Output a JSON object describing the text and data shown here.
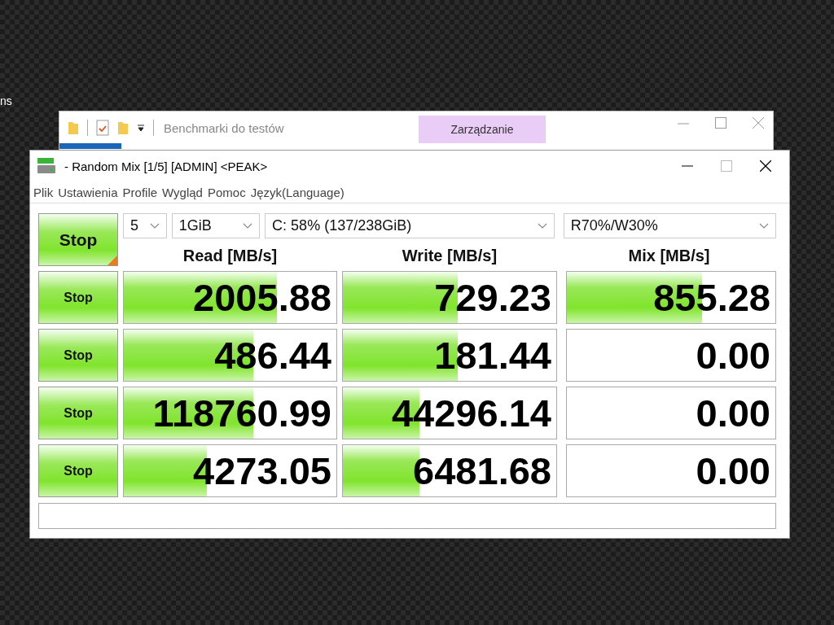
{
  "desktop": {
    "label": "ns"
  },
  "explorer": {
    "title": "Benchmarki do testów",
    "ribbon_tab": {
      "label": "Zarządzanie"
    }
  },
  "window": {
    "title": "- Random Mix [1/5] [ADMIN] <PEAK>",
    "menu": [
      "Plik",
      "Ustawienia",
      "Profile",
      "Wygląd",
      "Pomoc",
      "Język(Language)"
    ],
    "settings": {
      "count": "5",
      "size": "1GiB",
      "drive": "C: 58% (137/238GiB)",
      "mix": "R70%/W30%"
    },
    "main_button": "Stop",
    "columns": [
      "Read [MB/s]",
      "Write [MB/s]",
      "Mix [MB/s]"
    ],
    "rows": [
      {
        "button": "Stop",
        "cells": [
          {
            "value": "2005.88",
            "level": 0.72
          },
          {
            "value": "729.23",
            "level": 0.54
          },
          {
            "value": "855.28",
            "level": 0.65
          }
        ]
      },
      {
        "button": "Stop",
        "cells": [
          {
            "value": "486.44",
            "level": 0.61
          },
          {
            "value": "181.44",
            "level": 0.54
          },
          {
            "value": "0.00"
          }
        ]
      },
      {
        "button": "Stop",
        "cells": [
          {
            "value": "118760.99",
            "level": 0.61
          },
          {
            "value": "44296.14",
            "level": 0.36
          },
          {
            "value": "0.00"
          }
        ]
      },
      {
        "button": "Stop",
        "cells": [
          {
            "value": "4273.05",
            "level": 0.39
          },
          {
            "value": "6481.68",
            "level": 0.36
          },
          {
            "value": "0.00"
          }
        ]
      }
    ]
  }
}
